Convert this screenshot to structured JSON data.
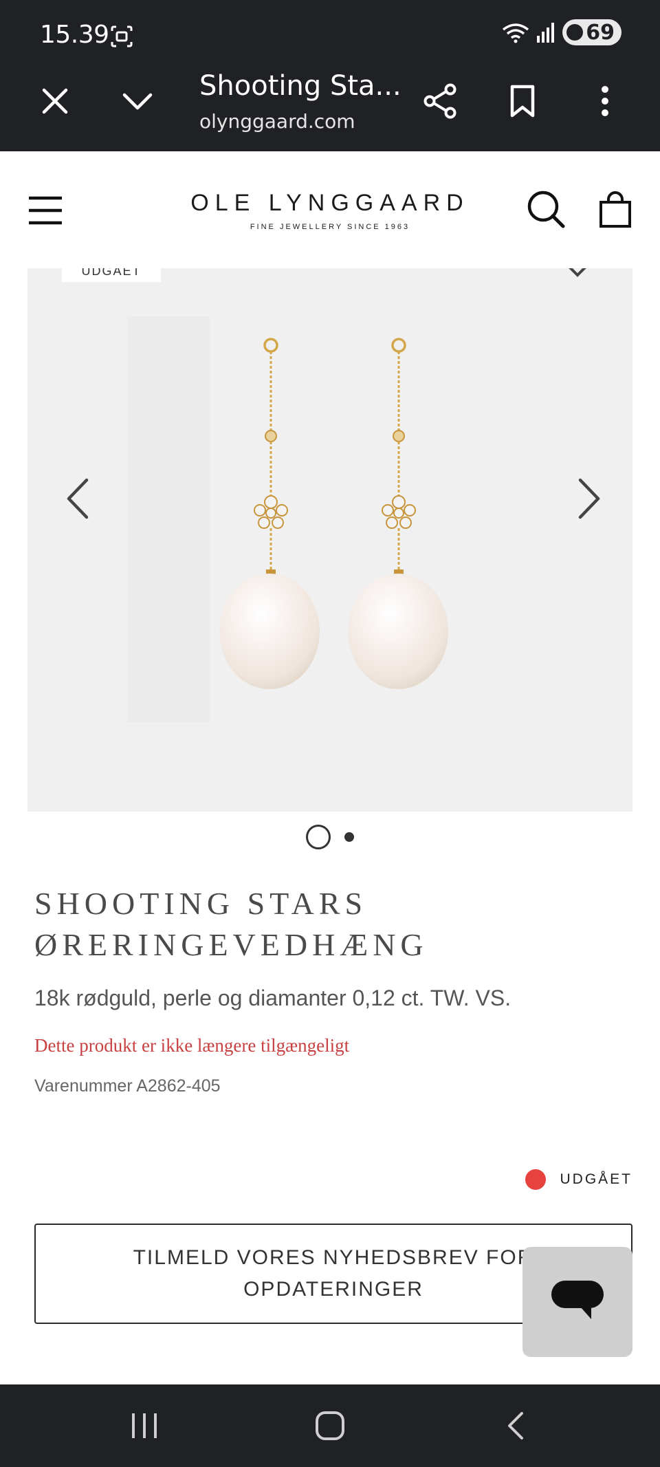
{
  "status_bar": {
    "time": "15.39",
    "battery": "69",
    "icons": [
      "screenshot-icon",
      "wifi-icon",
      "signal-icon",
      "battery-icon"
    ]
  },
  "browser": {
    "tab_title": "Shooting Sta...",
    "url": "olynggaard.com",
    "icons": [
      "close-icon",
      "chevron-down-icon",
      "share-icon",
      "bookmark-icon",
      "more-vertical-icon"
    ]
  },
  "site": {
    "logo": "OLE LYNGGAARD",
    "tagline": "FINE JEWELLERY SINCE 1963",
    "icons": [
      "hamburger-menu-icon",
      "search-icon",
      "shopping-bag-icon"
    ]
  },
  "gallery": {
    "badge": "UDGÅET",
    "slides_total": 2,
    "active_slide": 1,
    "icons": [
      "chevron-left-icon",
      "chevron-right-icon",
      "heart-icon"
    ]
  },
  "product": {
    "title": "SHOOTING STARS ØRERINGEVEDHÆNG",
    "description": "18k rødguld, perle og diamanter 0,12 ct. TW. VS.",
    "availability": "Dette produkt er ikke længere tilgængeligt",
    "sku": "Varenummer A2862-405",
    "status_label": "UDGÅET",
    "status_color": "#e8423f"
  },
  "newsletter_button": "TILMELD VORES NYHEDSBREV FOR OPDATERINGER",
  "colors": {
    "chrome": "#202125",
    "accent_red": "#c94040",
    "gallery_bg": "#f0f0f0"
  }
}
